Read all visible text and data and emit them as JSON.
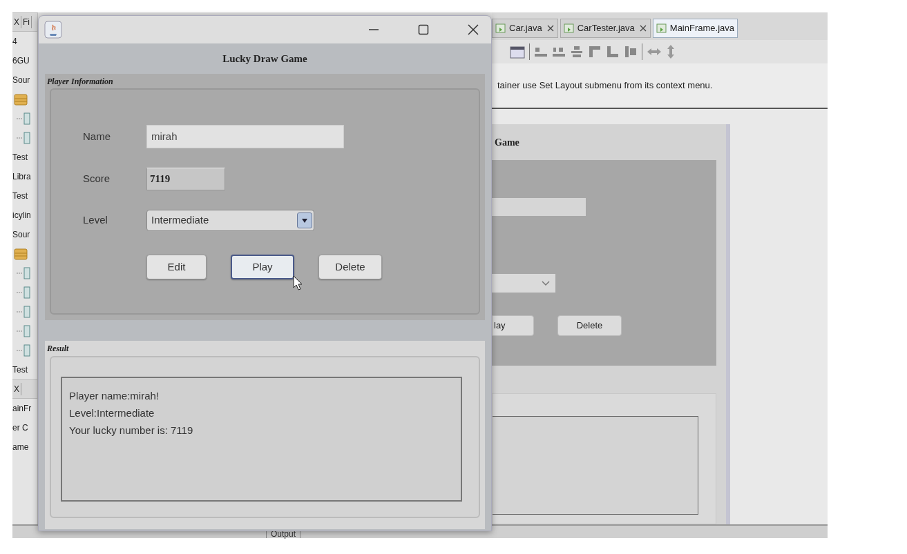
{
  "ide": {
    "left_strip": [
      {
        "kind": "tabs",
        "texts": [
          "X",
          "Fi"
        ]
      },
      {
        "kind": "text",
        "text": "4"
      },
      {
        "kind": "text",
        "text": "6GU"
      },
      {
        "kind": "text",
        "text": "Sour"
      },
      {
        "kind": "folder"
      },
      {
        "kind": "file"
      },
      {
        "kind": "file"
      },
      {
        "kind": "text",
        "text": "Test"
      },
      {
        "kind": "text",
        "text": "Libra"
      },
      {
        "kind": "text",
        "text": "Test"
      },
      {
        "kind": "text",
        "text": "icylin"
      },
      {
        "kind": "text",
        "text": "Sour"
      },
      {
        "kind": "folder"
      },
      {
        "kind": "file"
      },
      {
        "kind": "file"
      },
      {
        "kind": "file"
      },
      {
        "kind": "file"
      },
      {
        "kind": "file"
      },
      {
        "kind": "text",
        "text": "Test"
      },
      {
        "kind": "tabs",
        "texts": [
          "X"
        ]
      },
      {
        "kind": "text",
        "text": "ainFr"
      },
      {
        "kind": "text",
        "text": "er C"
      },
      {
        "kind": "text",
        "text": "ame"
      }
    ],
    "editor_tabs": [
      {
        "label": "Car.java",
        "selected": false
      },
      {
        "label": "CarTester.java",
        "selected": false
      },
      {
        "label": "MainFrame.java",
        "selected": true
      }
    ],
    "hint": "tainer use Set Layout submenu from its context menu.",
    "form_preview": {
      "title": "Game",
      "buttons": [
        "lay",
        "Delete"
      ]
    },
    "output_tab": "Output"
  },
  "window": {
    "title": "Lucky Draw Game",
    "player_panel": {
      "title": "Player Information",
      "fields": [
        {
          "label": "Name",
          "kind": "text",
          "value": "mirah"
        },
        {
          "label": "Score",
          "kind": "readonly",
          "value": "7119"
        },
        {
          "label": "Level",
          "kind": "combo",
          "value": "Intermediate"
        }
      ],
      "buttons": [
        {
          "label": "Edit",
          "focused": false
        },
        {
          "label": "Play",
          "focused": true
        },
        {
          "label": "Delete",
          "focused": false
        }
      ]
    },
    "result_panel": {
      "title": "Result",
      "lines": [
        "Player name:mirah!",
        "Level:Intermediate",
        "Your lucky number is: 7119"
      ]
    }
  }
}
